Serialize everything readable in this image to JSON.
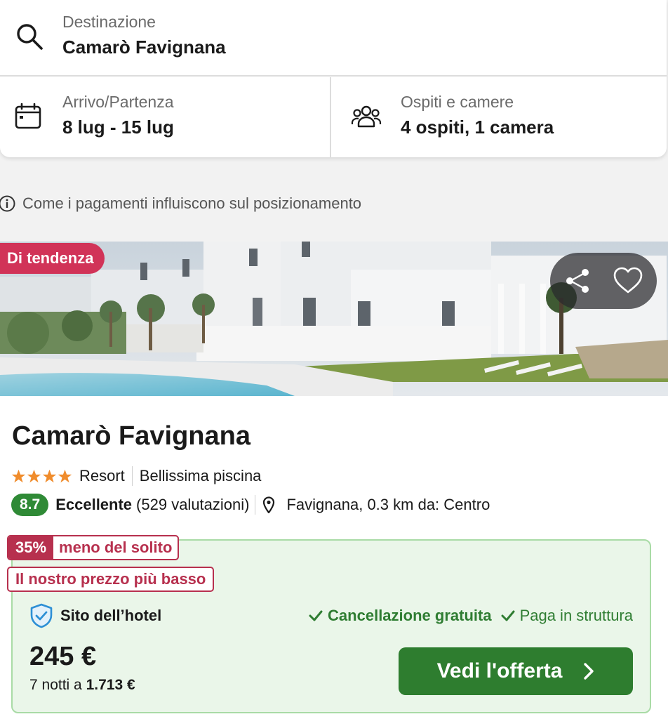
{
  "search": {
    "destination_label": "Destinazione",
    "destination_value": "Camarò Favignana",
    "dates_label": "Arrivo/Partenza",
    "dates_value": "8 lug - 15 lug",
    "guests_label": "Ospiti e camere",
    "guests_value": "4 ospiti, 1 camera"
  },
  "info": {
    "text": "Come i pagamenti influiscono sul posizionamento",
    "icon": "info-icon"
  },
  "hotel": {
    "badge": "Di tendenza",
    "name": "Camarò Favignana",
    "stars": 4,
    "type": "Resort",
    "highlight": "Bellissima piscina",
    "rating_score": "8.7",
    "rating_word": "Eccellente",
    "rating_count": "(529 valutazioni)",
    "location": "Favignana, 0.3 km da: Centro"
  },
  "deal": {
    "discount_pct": "35%",
    "discount_text": "meno del solito",
    "lowest_text": "Il nostro prezzo più basso",
    "provider": "Sito dell’hotel",
    "perk_free_cancel": "Cancellazione gratuita",
    "perk_pay": "Paga in struttura",
    "price": "245 €",
    "nights_prefix": "7 notti a",
    "nights_total": "1.713 €",
    "cta": "Vedi l'offerta"
  },
  "colors": {
    "badge": "#d13358",
    "rating": "#2f8a36",
    "cta": "#2e7d2f",
    "deal_bg": "#eaf6e9",
    "discount": "#b7304e",
    "star": "#f08c2c"
  }
}
